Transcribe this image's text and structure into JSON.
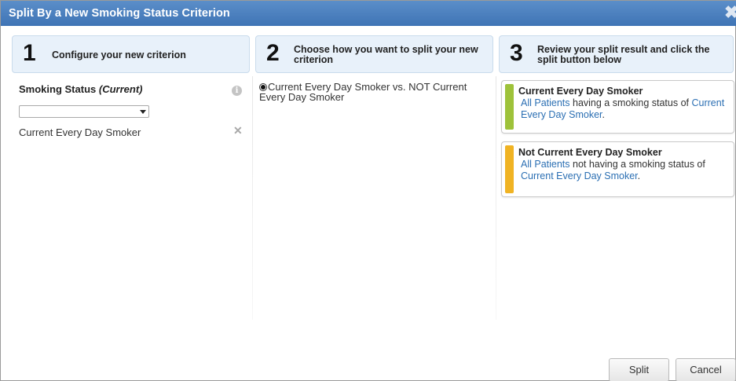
{
  "dialog": {
    "title": "Split By a New Smoking Status Criterion",
    "close_icon": "close-icon"
  },
  "steps": [
    {
      "number": "1",
      "text": "Configure your new criterion"
    },
    {
      "number": "2",
      "text": "Choose how you want to split your new criterion"
    },
    {
      "number": "3",
      "text": "Review your split result and click the split button below"
    }
  ],
  "step1": {
    "label": "Smoking Status",
    "label_qualifier": "(Current)",
    "info_icon": "info-icon",
    "dropdown_value": "",
    "selected_value": "Current Every Day Smoker",
    "remove_icon": "close-icon"
  },
  "step2": {
    "option_label": "Current Every Day Smoker vs. NOT Current Every Day Smoker",
    "selected": true
  },
  "step3": {
    "cards": [
      {
        "title": "Current Every Day Smoker",
        "link_text": "All Patients",
        "middle_text": " having a smoking status of ",
        "value_link": "Current Every Day Smoker",
        "end_text": ".",
        "color": "#9ec23a"
      },
      {
        "title": "Not Current Every Day Smoker",
        "link_text": "All Patients",
        "middle_text": " not having a smoking status of ",
        "value_link": "Current Every Day Smoker",
        "end_text": ".",
        "color": "#f0b323"
      }
    ]
  },
  "buttons": {
    "split": "Split",
    "cancel": "Cancel"
  },
  "colors": {
    "titlebar": "#4a80bf",
    "step_header_bg": "#e8f1fa",
    "link": "#2b6fb3"
  }
}
